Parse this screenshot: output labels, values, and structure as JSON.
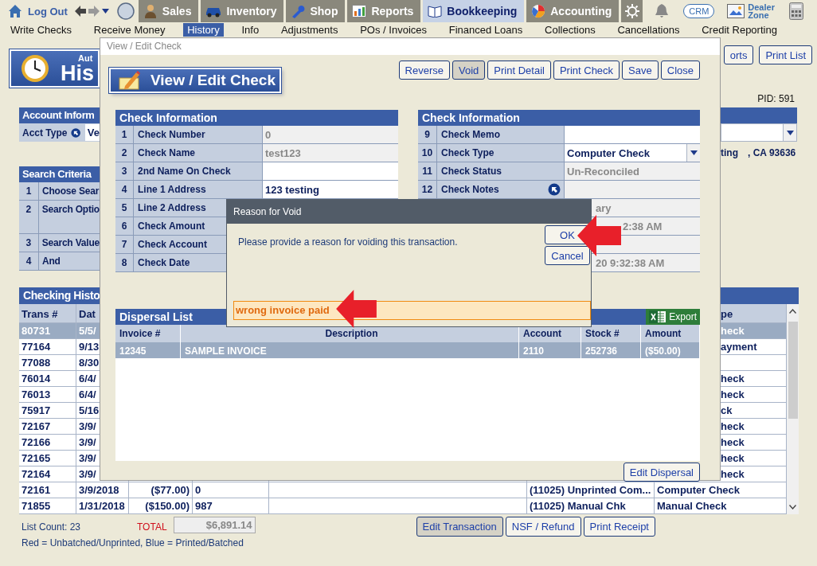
{
  "top_bar": {
    "logout": "Log Out",
    "modules": [
      {
        "label": "Sales",
        "selected": false
      },
      {
        "label": "Inventory",
        "selected": false
      },
      {
        "label": "Shop",
        "selected": false
      },
      {
        "label": "Reports",
        "selected": false
      },
      {
        "label": "Bookkeeping",
        "selected": true
      },
      {
        "label": "Accounting",
        "selected": false
      }
    ],
    "crm": "CRM",
    "dealer_zone": "Dealer Zone"
  },
  "sub_nav": [
    {
      "label": "Write Checks",
      "selected": false
    },
    {
      "label": "Receive Money",
      "selected": false
    },
    {
      "label": "History",
      "selected": true
    },
    {
      "label": "Info",
      "selected": false
    },
    {
      "label": "Adjustments",
      "selected": false
    },
    {
      "label": "POs / Invoices",
      "selected": false
    },
    {
      "label": "Financed Loans",
      "selected": false
    },
    {
      "label": "Collections",
      "selected": false
    },
    {
      "label": "Cancellations",
      "selected": false
    },
    {
      "label": "Credit Reporting",
      "selected": false
    }
  ],
  "page": {
    "header_caption": "Aut",
    "header_title": "His",
    "buttons": [
      "orts",
      "Print List"
    ],
    "pid": "PID: 591",
    "account": {
      "title": "Account Inform",
      "acct_type_label": "Acct Type",
      "acct_type_value": "Ve",
      "address_tail": "ting",
      "address_state": ", CA 93636"
    },
    "search": {
      "title": "Search Criteria",
      "rows": [
        {
          "number": "1",
          "label": "Choose Sear"
        },
        {
          "number": "2",
          "label": "Search Optio"
        },
        {
          "number": "3",
          "label": "Search Value"
        },
        {
          "number": "4",
          "label": "And"
        }
      ]
    },
    "history": {
      "title": "Checking Histo",
      "columns": {
        "trans": "Trans #",
        "date": "Dat",
        "type": "pe"
      },
      "rows": [
        {
          "kind": "partial",
          "selected": true,
          "trans": "80731",
          "date": "5/5/",
          "type": "heck"
        },
        {
          "kind": "partial",
          "selected": false,
          "trans": "77164",
          "date": "9/13",
          "type": "ayment"
        },
        {
          "kind": "partial",
          "selected": false,
          "trans": "77088",
          "date": "8/30"
        },
        {
          "kind": "partial",
          "selected": false,
          "trans": "76014",
          "date": "6/4/",
          "type": "heck"
        },
        {
          "kind": "partial",
          "selected": false,
          "trans": "76013",
          "date": "6/4/",
          "type": "heck"
        },
        {
          "kind": "partial",
          "selected": false,
          "trans": "75917",
          "date": "5/16",
          "type": "ck"
        },
        {
          "kind": "partial",
          "selected": false,
          "trans": "72167",
          "date": "3/9/",
          "type": "heck"
        },
        {
          "kind": "partial",
          "selected": false,
          "trans": "72166",
          "date": "3/9/",
          "type": "heck"
        },
        {
          "kind": "partial",
          "selected": false,
          "trans": "72165",
          "date": "3/9/",
          "type": "heck"
        },
        {
          "kind": "partial",
          "selected": false,
          "trans": "72164",
          "date": "3/9/",
          "type": "heck"
        },
        {
          "kind": "full",
          "selected": false,
          "trans": "72161",
          "date": "3/9/2018",
          "amount": "($77.00)",
          "reference": "0",
          "account": "(11025) Unprinted Com...",
          "type": "Computer Check"
        },
        {
          "kind": "full",
          "selected": false,
          "trans": "71855",
          "date": "1/31/2018",
          "amount": "($150.00)",
          "reference": "987",
          "account": "(11025) Manual Chk",
          "type": "Manual Check"
        }
      ]
    },
    "list_count": "List Count: 23",
    "total_label": "TOTAL",
    "total_value": "$6,891.14",
    "legend": "Red = Unbatched/Unprinted, Blue = Printed/Batched",
    "footer_buttons": [
      {
        "label": "Edit Transaction",
        "pressed": true
      },
      {
        "label": "NSF / Refund",
        "pressed": false
      },
      {
        "label": "Print Receipt",
        "pressed": false
      }
    ]
  },
  "check_dialog": {
    "title": "View / Edit Check",
    "heading": "View / Edit Check",
    "buttons": [
      {
        "label": "Reverse",
        "pressed": false
      },
      {
        "label": "Void",
        "pressed": true
      },
      {
        "label": "Print Detail",
        "pressed": false
      },
      {
        "label": "Print Check",
        "pressed": false
      },
      {
        "label": "Save",
        "pressed": false
      },
      {
        "label": "Close",
        "pressed": false
      }
    ],
    "left_panel": {
      "title": "Check Information",
      "rows": [
        {
          "number": "1",
          "label": "Check Number",
          "kind": "readonly",
          "value": "0"
        },
        {
          "number": "2",
          "label": "Check Name",
          "kind": "readonly",
          "value": "test123"
        },
        {
          "number": "3",
          "label": "2nd Name On Check",
          "kind": "input"
        },
        {
          "number": "4",
          "label": "Line 1 Address",
          "kind": "input",
          "value": "123 testing"
        },
        {
          "number": "5",
          "label": "Line 2 Address",
          "kind": "covered"
        },
        {
          "number": "6",
          "label": "Check Amount",
          "kind": "covered"
        },
        {
          "number": "7",
          "label": "Check Account",
          "kind": "covered"
        },
        {
          "number": "8",
          "label": "Check Date",
          "kind": "covered"
        }
      ]
    },
    "right_panel": {
      "title": "Check Information",
      "rows": [
        {
          "number": "9",
          "label": "Check Memo",
          "kind": "input"
        },
        {
          "number": "10",
          "label": "Check Type",
          "kind": "select",
          "value": "Computer Check"
        },
        {
          "number": "11",
          "label": "Check Status",
          "kind": "readonly",
          "value": "Un-Reconciled"
        },
        {
          "number": "12",
          "label": "Check Notes",
          "kind": "notes"
        },
        {
          "kind": "tail",
          "value": "ary"
        },
        {
          "kind": "tail_far",
          "value": "2:38 AM"
        },
        {
          "kind": "blank"
        },
        {
          "kind": "tail",
          "value": "20 9:32:38 AM"
        }
      ]
    },
    "dispersal": {
      "title": "Dispersal List",
      "export": "Export",
      "columns": [
        "Invoice #",
        "Description",
        "Account",
        "Stock #",
        "Amount"
      ],
      "rows": [
        {
          "selected": true,
          "cells": [
            "12345",
            "SAMPLE INVOICE",
            "2110",
            "252736",
            "($50.00)"
          ]
        }
      ]
    },
    "edit_dispersal": "Edit Dispersal"
  },
  "void_dialog": {
    "title": "Reason for Void",
    "message": "Please provide a reason for voiding this transaction.",
    "buttons": [
      {
        "label": "OK",
        "pressed": false
      },
      {
        "label": "Cancel",
        "pressed": false
      }
    ],
    "reason": "wrong invoice paid"
  }
}
